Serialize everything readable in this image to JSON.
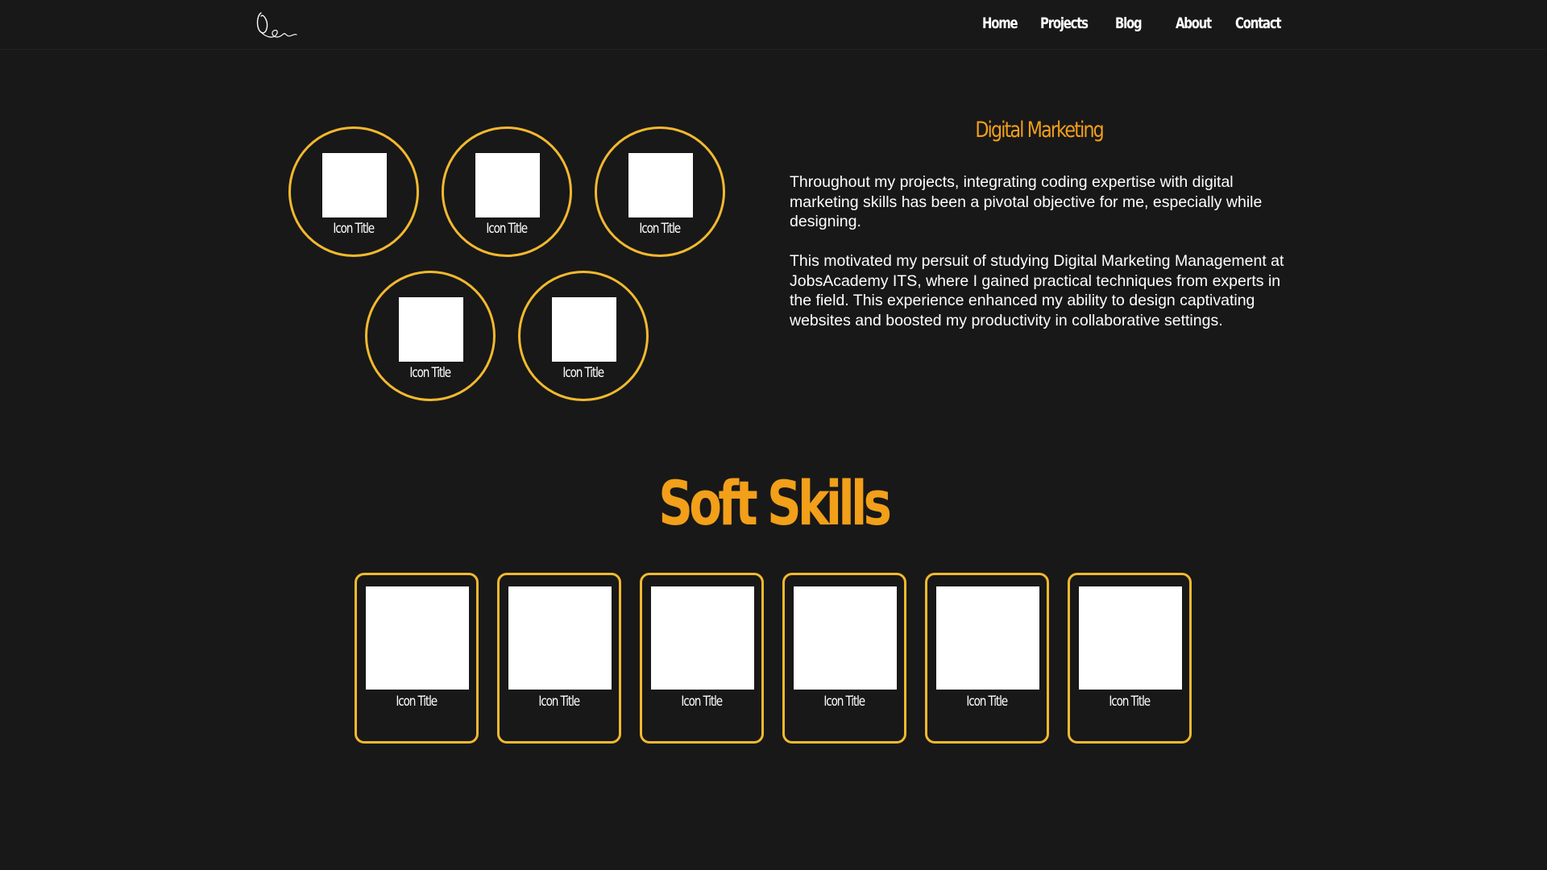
{
  "nav": {
    "logo_alt": "signature logo",
    "links": [
      "Home",
      "Projects",
      "Blog",
      "About",
      "Contact"
    ]
  },
  "hard_skills": {
    "icons": [
      {
        "title": "Icon Title"
      },
      {
        "title": "Icon Title"
      },
      {
        "title": "Icon Title"
      },
      {
        "title": "Icon Title"
      },
      {
        "title": "Icon Title"
      }
    ]
  },
  "digital_marketing": {
    "title": "Digital Marketing",
    "paragraphs": [
      "Throughout my projects, integrating coding expertise with digital marketing skills has been a pivotal objective for me, especially while designing.",
      "This motivated my persuit of studying Digital Marketing Management at JobsAcademy ITS, where I gained practical techniques from experts in the field. This experience enhanced my ability to design captivating websites and boosted my productivity in collaborative settings."
    ]
  },
  "soft_skills": {
    "title": "Soft Skills",
    "cards": [
      {
        "title": "Icon Title"
      },
      {
        "title": "Icon Title"
      },
      {
        "title": "Icon Title"
      },
      {
        "title": "Icon Title"
      },
      {
        "title": "Icon Title"
      },
      {
        "title": "Icon Title"
      }
    ]
  },
  "colors": {
    "background": "#181818",
    "accent_orange": "#f29f1a",
    "accent_yellow_border": "#f2b92e",
    "text": "#ffffff"
  }
}
